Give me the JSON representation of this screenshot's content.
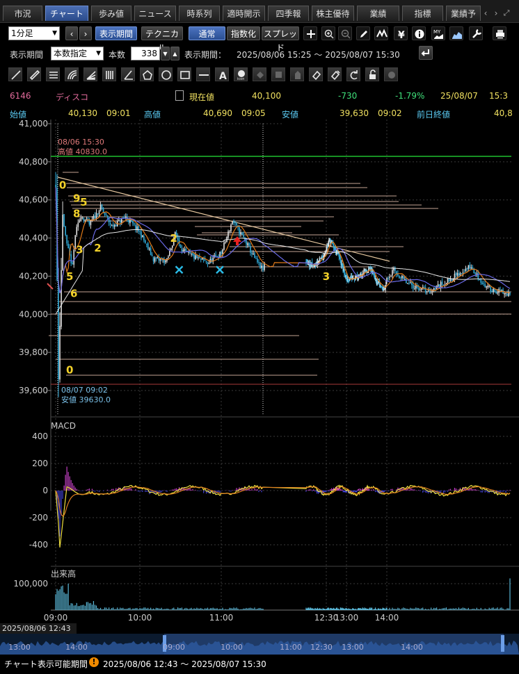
{
  "tabs": [
    {
      "label": "市況"
    },
    {
      "label": "チャート",
      "active": true
    },
    {
      "label": "歩み値"
    },
    {
      "label": "ニュース"
    },
    {
      "label": "時系列"
    },
    {
      "label": "適時開示"
    },
    {
      "label": "四季報"
    },
    {
      "label": "株主優待"
    },
    {
      "label": "業績"
    },
    {
      "label": "指標"
    },
    {
      "label": "業績予"
    }
  ],
  "toolbar": {
    "interval": "1分足",
    "display_period": "表示期間",
    "technical": "テクニカル",
    "normal": "通常",
    "index": "指数化",
    "spread": "スプレッド",
    "icons": [
      "plus-icon",
      "zoom-in-icon",
      "zoom-out-icon",
      "pencil-icon",
      "wave-icon",
      "yen-icon",
      "info-icon",
      "my-icon",
      "area-chart-icon",
      "wrench-icon",
      "print-icon"
    ]
  },
  "period": {
    "label": "表示期間",
    "mode": "本数指定",
    "count_label": "本数",
    "count": "338",
    "range_label": "表示期間：",
    "range": "2025/08/06 15:25 ～ 2025/08/07 15:30"
  },
  "drawing_tools": [
    "line-tool-icon",
    "ruler-tool-icon",
    "hlines-tool-icon",
    "fib-tool-icon",
    "fan-tool-icon",
    "vlines-tool-icon",
    "angle-tool-icon",
    "pentagon-tool-icon",
    "circle-tool-icon",
    "rect-tool-icon",
    "hline-tool-icon",
    "text-tool-icon",
    "stamp-tool-icon",
    "move-tool-icon",
    "copy-tool-icon",
    "hand-tool-icon",
    "eraser-tool-icon",
    "erase-all-tool-icon",
    "undo-tool-icon",
    "lock-tool-icon",
    "settings-tool-icon"
  ],
  "quote": {
    "code": "6146",
    "name": "ディスコ",
    "current_label": "現在値",
    "current": "40,100",
    "change": "-730",
    "change_pct": "-1.79%",
    "date": "25/08/07",
    "time": "15:3",
    "open_label": "始値",
    "open": "40,130",
    "open_time": "09:01",
    "high_label": "高値",
    "high": "40,690",
    "high_time": "09:05",
    "low_label": "安値",
    "low": "39,630",
    "low_time": "09:02",
    "prev_label": "前日終値",
    "prev": "40,8"
  },
  "colors": {
    "up": "#e6e6e6",
    "down": "#35b8e0",
    "ma_short": "#e07a1a",
    "ma_mid": "#6a6ae8",
    "ma_long": "#e8e8e8",
    "trend": "#e8c9a0",
    "green_line": "#1fbf2f",
    "red_line": "#a83a3a",
    "annotation": "#f2d12a",
    "cross": "#2bbde8",
    "arrow": "#e82020",
    "macd": "#f0e040",
    "signal": "#e08020",
    "hist_pos": "#c040c0",
    "hist_neg": "#4040d0",
    "volume": "#5ab8d8"
  },
  "chart_data": [
    {
      "type": "candlestick",
      "y_ticks": [
        "41,000",
        "40,800",
        "40,600",
        "40,400",
        "40,200",
        "40,000",
        "39,800",
        "39,600"
      ],
      "ylim": [
        39600,
        41000
      ],
      "x_ticks": [
        "09:00",
        "10:00",
        "11:00",
        "12:30",
        "13:00",
        "14:00"
      ],
      "high_marker": {
        "time": "08/06 15:30",
        "label": "高値 40830.0",
        "value": 40830
      },
      "low_marker": {
        "time": "08/07 09:02",
        "label": "安値 39630.0",
        "value": 39630
      },
      "wave_labels": [
        {
          "text": "0",
          "time": "09:05",
          "value": 40660
        },
        {
          "text": "9",
          "time": "09:15",
          "value": 40590
        },
        {
          "text": "5",
          "time": "09:20",
          "value": 40570
        },
        {
          "text": "8",
          "time": "09:15",
          "value": 40510
        },
        {
          "text": "3",
          "time": "09:17",
          "value": 40320
        },
        {
          "text": "2",
          "time": "09:30",
          "value": 40330
        },
        {
          "text": "2",
          "time": "10:25",
          "value": 40380
        },
        {
          "text": "5",
          "time": "09:10",
          "value": 40180
        },
        {
          "text": "6",
          "time": "09:13",
          "value": 40090
        },
        {
          "text": "3",
          "time": "12:30",
          "value": 40180
        },
        {
          "text": "0",
          "time": "09:10",
          "value": 39690
        }
      ],
      "cross_marks": [
        {
          "time": "10:30",
          "value": 40270
        },
        {
          "time": "11:00",
          "value": 40270
        }
      ],
      "arrow_marks": [
        {
          "time": "11:10",
          "value": 40380
        }
      ]
    },
    {
      "type": "line",
      "title": "MACD",
      "y_ticks": [
        "400",
        "200",
        "0",
        "-200",
        "-400"
      ],
      "ylim": [
        -450,
        450
      ]
    },
    {
      "type": "bar",
      "title": "出来高",
      "y_ticks": [
        "100,000"
      ],
      "ylim": [
        0,
        120000
      ]
    }
  ],
  "navigator": {
    "start_label": "2025/08/06 12:43",
    "ticks": [
      "13:00",
      "14:00",
      "09:00",
      "10:00",
      "11:00",
      "12:30",
      "13:00",
      "14:00"
    ]
  },
  "footer": {
    "label": "チャート表示可能期間",
    "range": "2025/08/06 12:43 ～ 2025/08/07 15:30"
  }
}
